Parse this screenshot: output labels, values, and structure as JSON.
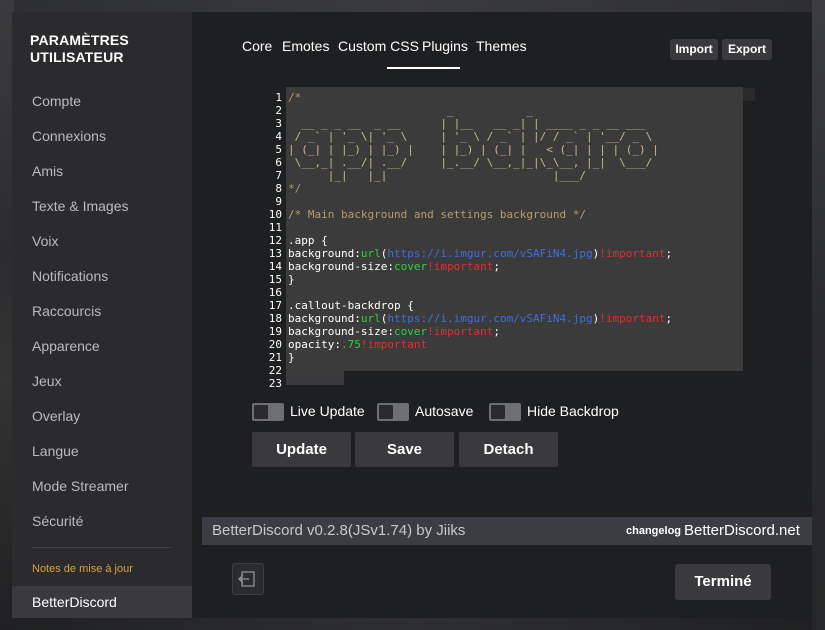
{
  "sidebar": {
    "title": "PARAMÈTRES UTILISATEUR",
    "items": [
      {
        "label": "Compte"
      },
      {
        "label": "Connexions"
      },
      {
        "label": "Amis"
      },
      {
        "label": "Texte & Images"
      },
      {
        "label": "Voix"
      },
      {
        "label": "Notifications"
      },
      {
        "label": "Raccourcis"
      },
      {
        "label": "Apparence"
      },
      {
        "label": "Jeux"
      },
      {
        "label": "Overlay"
      },
      {
        "label": "Langue"
      },
      {
        "label": "Mode Streamer"
      },
      {
        "label": "Sécurité"
      }
    ],
    "notes_label": "Notes de mise à jour",
    "selected_item": "BetterDiscord",
    "notes_color": "#d9a33a"
  },
  "tabs": [
    {
      "label": "Core"
    },
    {
      "label": "Emotes"
    },
    {
      "label": "Custom CSS"
    },
    {
      "label": "Plugins"
    },
    {
      "label": "Themes"
    }
  ],
  "active_tab": "Custom CSS",
  "actions": {
    "import_label": "Import",
    "export_label": "Export"
  },
  "editor": {
    "line_numbers": [
      "1",
      "2",
      "3",
      "4",
      "5",
      "6",
      "7",
      "8",
      "9",
      "10",
      "11",
      "12",
      "13",
      "14",
      "15",
      "16",
      "17",
      "18",
      "19",
      "20",
      "21",
      "22",
      "23"
    ],
    "lines": [
      "/*",
      "",
      "                        _           _",
      "  __ _ _ __  _ __      | |__   __ _| | ____ _ _ __ ___",
      " / _` | '_ \\| '_ \\     | '_ \\ / _` | |/ / _` | '__/ _ \\",
      "| (_| | |_) | |_) |    | |_) | (_| |   < (_| | | | (_) |",
      " \\__,_| .__/| .__/     |_.__/ \\__,_|_|\\_\\__, |_|  \\___/",
      "      |_|   |_|                         |___/",
      "*/",
      "",
      "/* Main background and settings background */",
      "",
      ".app {",
      "background:url(https://i.imgur.com/vSAFiN4.jpg)!important;",
      "background-size:cover!important;",
      "}",
      "",
      ".callout-backdrop {",
      "background:url(https://i.imgur.com/vSAFiN4.jpg)!important;",
      "background-size:cover!important;",
      "opacity:.75!important",
      "}",
      ""
    ],
    "colors": {
      "background": "#3b3b3b",
      "comment": "#b89c6e",
      "function": "#2fd23a",
      "url": "#3f6de0",
      "important": "#e02f2f"
    }
  },
  "toggles": [
    {
      "label": "Live Update",
      "checked": false
    },
    {
      "label": "Autosave",
      "checked": false
    },
    {
      "label": "Hide Backdrop",
      "checked": false
    }
  ],
  "buttons": {
    "update": "Update",
    "save": "Save",
    "detach": "Detach"
  },
  "footer": {
    "version": "BetterDiscord v0.2.8(JSv1.74) by Jiiks",
    "changelog": "changelog",
    "link": "BetterDiscord.net"
  },
  "done_label": "Terminé",
  "back_icon": "exit-arrow-icon"
}
